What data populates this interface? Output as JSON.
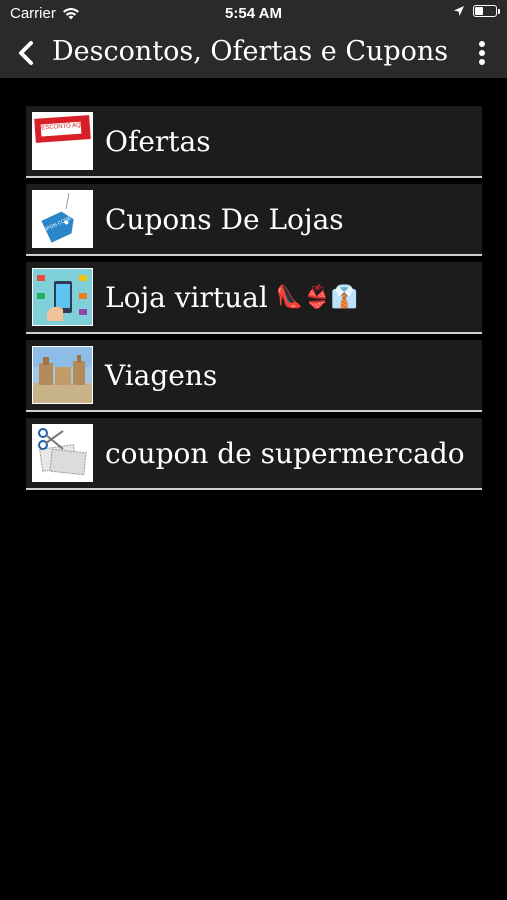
{
  "status_bar": {
    "carrier": "Carrier",
    "time": "5:54 AM"
  },
  "nav": {
    "title": "Descontos, Ofertas e Cupons",
    "back_icon": "chevron-left-icon",
    "more_icon": "vertical-ellipsis-icon"
  },
  "menu": {
    "items": [
      {
        "label": "Ofertas",
        "thumb_text": "DESCONTO AQUI",
        "thumb": "discount-banner"
      },
      {
        "label": "Cupons De Lojas",
        "thumb_text": "COUPON CODES",
        "thumb": "coupon-tag"
      },
      {
        "label": "Loja virtual",
        "emojis": "👠👙👔",
        "thumb": "online-shop"
      },
      {
        "label": "Viagens",
        "thumb": "travel-photo"
      },
      {
        "label": "coupon de supermercado",
        "thumb": "scissors-coupons"
      }
    ]
  },
  "colors": {
    "bar_background": "#2a2a2a",
    "page_background": "#000000",
    "row_background": "#1c1c1c",
    "row_separator": "#cfcfcf"
  }
}
